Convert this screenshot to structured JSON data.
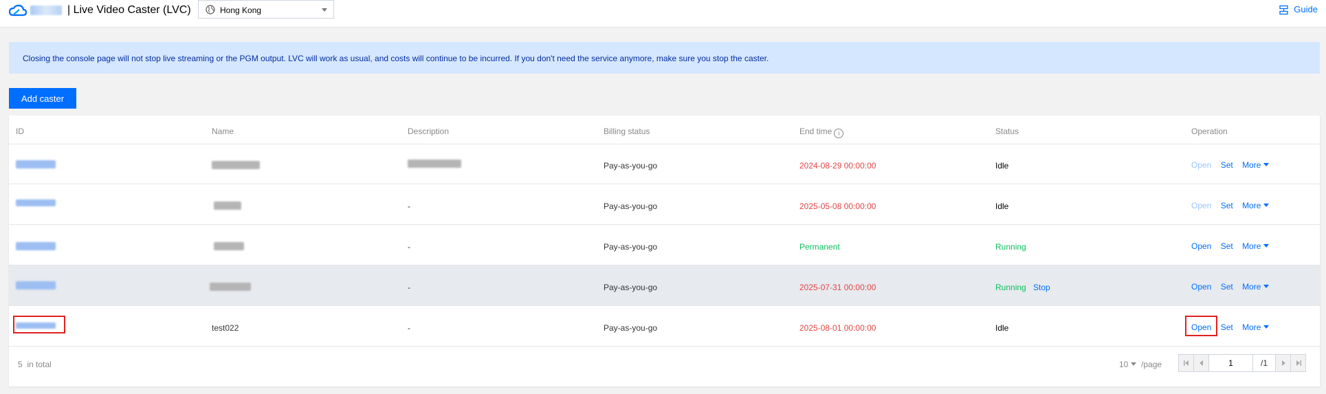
{
  "header": {
    "title": "| Live Video Caster (LVC)",
    "region": "Hong Kong",
    "guide": "Guide"
  },
  "notice": "Closing the console page will not stop live streaming or the PGM output. LVC will work as usual, and costs will continue to be incurred. If you don't need the service anymore, make sure you stop the caster.",
  "add_button": "Add caster",
  "table": {
    "columns": [
      "ID",
      "Name",
      "Description",
      "Billing status",
      "End time",
      "Status",
      "Operation"
    ],
    "rows": [
      {
        "id": "",
        "name": "",
        "description": "",
        "billing": "Pay-as-you-go",
        "end_time": "2024-08-29 00:00:00",
        "status": "Idle",
        "stop": "",
        "open": "Open",
        "set": "Set",
        "more": "More"
      },
      {
        "id": "",
        "name": "",
        "description": "-",
        "billing": "Pay-as-you-go",
        "end_time": "2025-05-08 00:00:00",
        "status": "Idle",
        "stop": "",
        "open": "Open",
        "set": "Set",
        "more": "More"
      },
      {
        "id": "",
        "name": "",
        "description": "-",
        "billing": "Pay-as-you-go",
        "end_time": "Permanent",
        "status": "Running",
        "stop": "",
        "open": "Open",
        "set": "Set",
        "more": "More"
      },
      {
        "id": "",
        "name": "",
        "description": "-",
        "billing": "Pay-as-you-go",
        "end_time": "2025-07-31 00:00:00",
        "status": "Running",
        "stop": "Stop",
        "open": "Open",
        "set": "Set",
        "more": "More"
      },
      {
        "id": "",
        "name": "test022",
        "description": "-",
        "billing": "Pay-as-you-go",
        "end_time": "2025-08-01 00:00:00",
        "status": "Idle",
        "stop": "",
        "open": "Open",
        "set": "Set",
        "more": "More"
      }
    ]
  },
  "footer": {
    "total_count": "5",
    "total_suffix": "in total",
    "page_size": "10",
    "page_size_suffix": "/page",
    "current_page": "1",
    "total_pages": "/1"
  },
  "colors": {
    "accent": "#006eff",
    "expired": "#e54545",
    "running": "#0abf5b",
    "highlight": "#e02020"
  }
}
